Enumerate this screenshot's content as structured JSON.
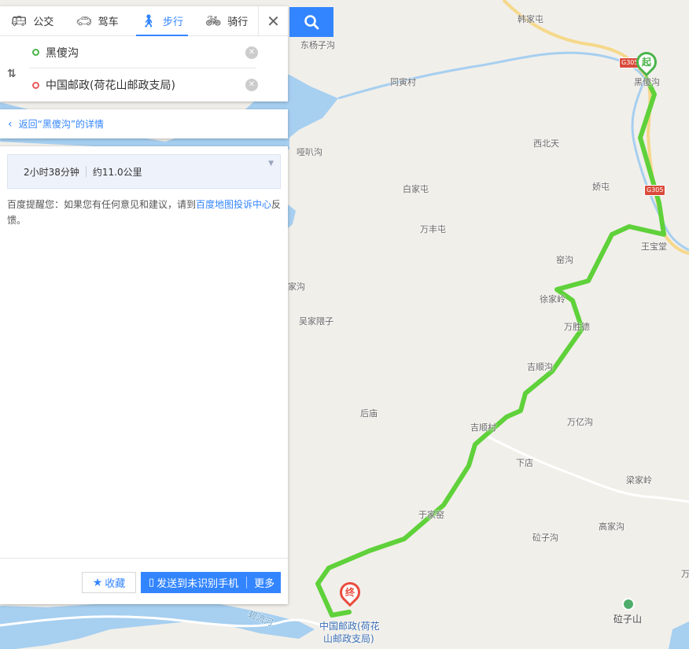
{
  "modes": [
    {
      "label": "公交",
      "icon": "bus-icon",
      "active": false
    },
    {
      "label": "驾车",
      "icon": "car-icon",
      "active": false
    },
    {
      "label": "步行",
      "icon": "walk-icon",
      "active": true
    },
    {
      "label": "骑行",
      "icon": "bike-icon",
      "active": false
    }
  ],
  "route": {
    "start": "黑傻沟",
    "end": "中国邮政(荷花山邮政支局)"
  },
  "back_link": "返回“黑傻沟”的详情",
  "summary": {
    "duration": "2小时38分钟",
    "distance": "约11.0公里"
  },
  "tip": {
    "prefix": "百度提醒您：如果您有任何意见和建议，请到",
    "link": "百度地图投诉中心",
    "suffix": "反馈。"
  },
  "actions": {
    "favorite": "收藏",
    "send_to_phone": "发送到未识别手机",
    "more": "更多"
  },
  "map": {
    "start_marker": "起",
    "end_marker": "终",
    "destination_label_1": "中国邮政(荷花",
    "destination_label_2": "山邮政支局)",
    "highway_badge": "G305",
    "river_label": "碧流河",
    "labels": [
      "韩家屯",
      "东杨子沟",
      "同寅村",
      "黑傻沟",
      "西北天",
      "哑叭沟",
      "白家屯",
      "娇屯",
      "万丰屯",
      "王宝堂",
      "窑沟",
      "郭家沟",
      "徐家岭",
      "吴家隈子",
      "万胜德",
      "吉顺沟",
      "后庙",
      "吉顺村",
      "万亿沟",
      "下店",
      "梁家岭",
      "于家窑",
      "高家沟",
      "砬子沟",
      "砬子山",
      "万"
    ]
  },
  "colors": {
    "accent": "#3385ff",
    "route": "#5fd13a",
    "water": "#a6cff0",
    "start": "#4ab44a",
    "end": "#e84c3d"
  }
}
